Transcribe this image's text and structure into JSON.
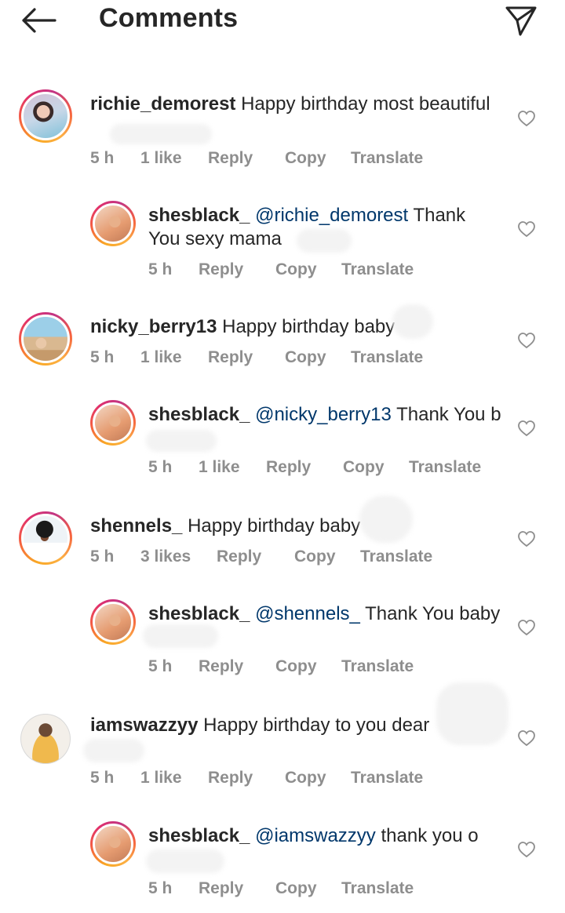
{
  "header": {
    "title": "Comments",
    "back_icon": "arrow-left-icon",
    "send_icon": "paper-plane-icon"
  },
  "comments": [
    {
      "username": "richie_demorest",
      "mention": "",
      "text": "Happy birthday most beautiful",
      "time": "5 h",
      "likes": "1 like",
      "reply": "Reply",
      "copy": "Copy",
      "translate": "Translate"
    },
    {
      "username": "shesblack_",
      "mention": "@richie_demorest",
      "text": "Thank You sexy mama",
      "time": "5 h",
      "likes": "",
      "reply": "Reply",
      "copy": "Copy",
      "translate": "Translate"
    },
    {
      "username": "nicky_berry13",
      "mention": "",
      "text": "Happy birthday baby",
      "time": "5 h",
      "likes": "1 like",
      "reply": "Reply",
      "copy": "Copy",
      "translate": "Translate"
    },
    {
      "username": "shesblack_",
      "mention": "@nicky_berry13",
      "text": "Thank You b",
      "time": "5 h",
      "likes": "1 like",
      "reply": "Reply",
      "copy": "Copy",
      "translate": "Translate"
    },
    {
      "username": "shennels_",
      "mention": "",
      "text": "Happy birthday baby",
      "time": "5 h",
      "likes": "3 likes",
      "reply": "Reply",
      "copy": "Copy",
      "translate": "Translate"
    },
    {
      "username": "shesblack_",
      "mention": "@shennels_",
      "text": "Thank You baby",
      "time": "5 h",
      "likes": "",
      "reply": "Reply",
      "copy": "Copy",
      "translate": "Translate"
    },
    {
      "username": "iamswazzyy",
      "mention": "",
      "text": "Happy birthday to you dear",
      "time": "5 h",
      "likes": "1 like",
      "reply": "Reply",
      "copy": "Copy",
      "translate": "Translate"
    },
    {
      "username": "shesblack_",
      "mention": "@iamswazzyy",
      "text": "thank you o",
      "time": "5 h",
      "likes": "",
      "reply": "Reply",
      "copy": "Copy",
      "translate": "Translate"
    }
  ],
  "colors": {
    "text": "#262626",
    "meta": "#8e8e8e",
    "mention": "#00376b"
  }
}
